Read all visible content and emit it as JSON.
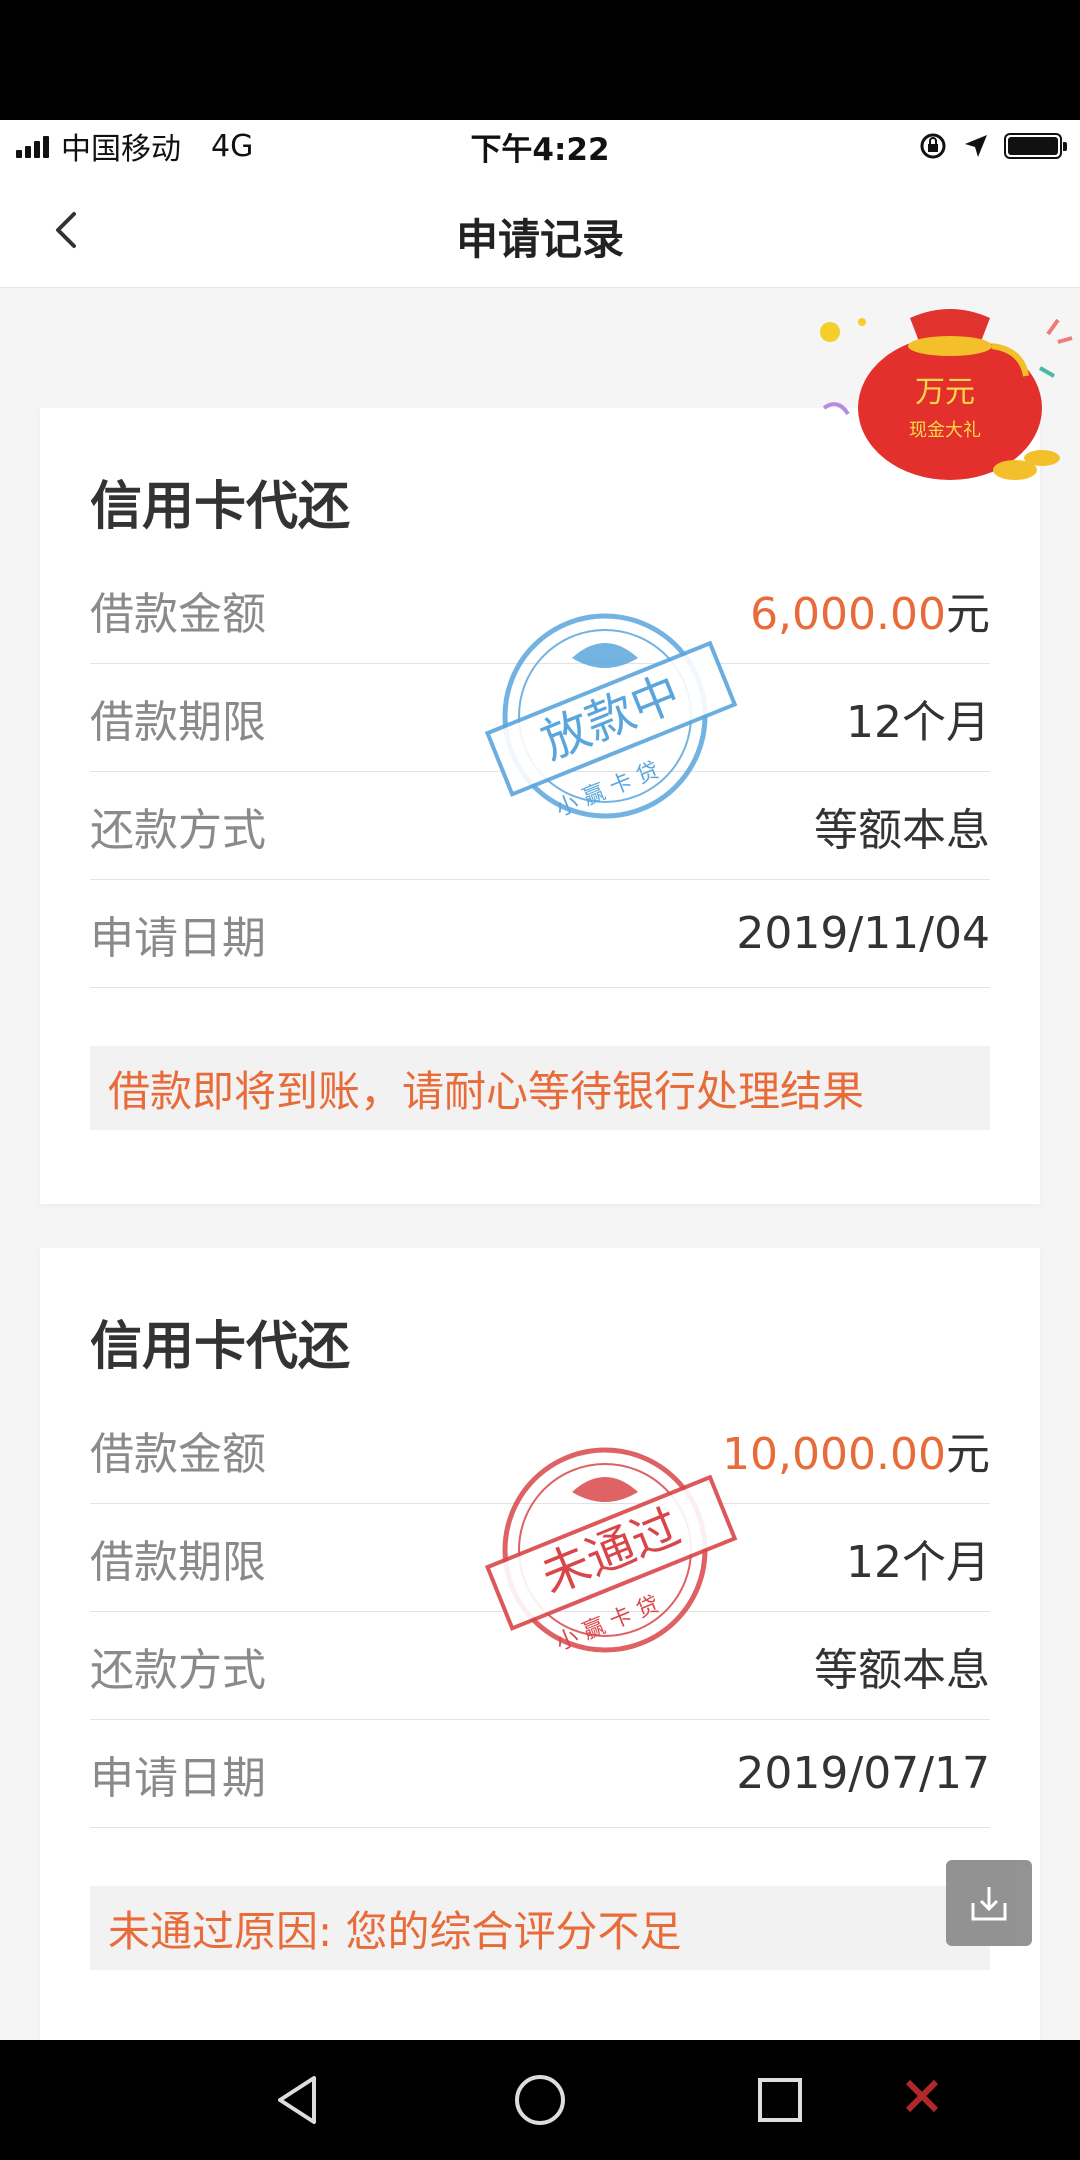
{
  "status_bar": {
    "carrier": "中国移动",
    "network": "4G",
    "time": "下午4:22"
  },
  "header": {
    "title": "申请记录"
  },
  "promo": {
    "line1": "万元",
    "line2": "现金大礼"
  },
  "records": [
    {
      "title": "信用卡代还",
      "amount_label": "借款金额",
      "amount_value": "6,000.00",
      "amount_unit": "元",
      "term_label": "借款期限",
      "term_value": "12个月",
      "method_label": "还款方式",
      "method_value": "等额本息",
      "date_label": "申请日期",
      "date_value": "2019/11/04",
      "notice": "借款即将到账，请耐心等待银行处理结果",
      "stamp_text": "放款中",
      "stamp_sub": "小 赢 卡 贷",
      "stamp_color": "#5aa6dc"
    },
    {
      "title": "信用卡代还",
      "amount_label": "借款金额",
      "amount_value": "10,000.00",
      "amount_unit": "元",
      "term_label": "借款期限",
      "term_value": "12个月",
      "method_label": "还款方式",
      "method_value": "等额本息",
      "date_label": "申请日期",
      "date_value": "2019/07/17",
      "notice": "未通过原因: 您的综合评分不足",
      "stamp_text": "未通过",
      "stamp_sub": "小 赢 卡 贷",
      "stamp_color": "#d9464a"
    }
  ],
  "colors": {
    "accent": "#e86b3a",
    "label": "#8a8a8a"
  }
}
